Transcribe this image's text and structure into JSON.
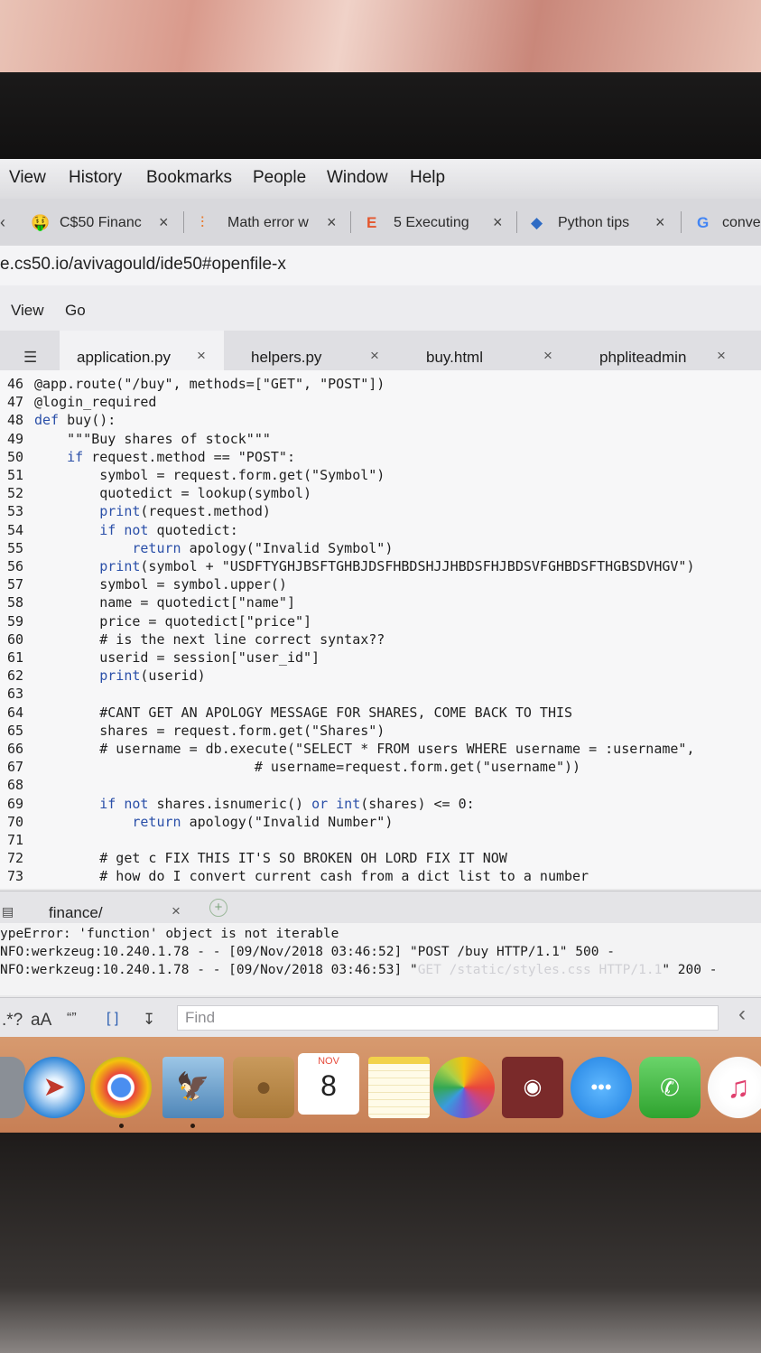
{
  "menubar": {
    "items": [
      "View",
      "History",
      "Bookmarks",
      "People",
      "Window",
      "Help"
    ]
  },
  "tabs": [
    {
      "label": "C$50 Financ",
      "icon": "money-face-icon"
    },
    {
      "label": "Math error w",
      "icon": "stack-overflow-icon"
    },
    {
      "label": "5 Executing",
      "icon": "e-logo-icon"
    },
    {
      "label": "Python tips",
      "icon": "python-icon"
    },
    {
      "label": "conve",
      "icon": "google-g-icon"
    }
  ],
  "url": "e.cs50.io/avivagould/ide50#openfile-x",
  "ide_menu": [
    "View",
    "Go"
  ],
  "editor_tabs": [
    "application.py",
    "helpers.py",
    "buy.html",
    "phpliteadmin"
  ],
  "code_lines": [
    {
      "n": "46",
      "t": "@app.route(\"/buy\", methods=[\"GET\", \"POST\"])"
    },
    {
      "n": "47",
      "t": "@login_required"
    },
    {
      "n": "48",
      "t": "def buy():"
    },
    {
      "n": "49",
      "t": "    \"\"\"Buy shares of stock\"\"\""
    },
    {
      "n": "50",
      "t": "    if request.method == \"POST\":"
    },
    {
      "n": "51",
      "t": "        symbol = request.form.get(\"Symbol\")"
    },
    {
      "n": "52",
      "t": "        quotedict = lookup(symbol)"
    },
    {
      "n": "53",
      "t": "        print(request.method)"
    },
    {
      "n": "54",
      "t": "        if not quotedict:"
    },
    {
      "n": "55",
      "t": "            return apology(\"Invalid Symbol\")"
    },
    {
      "n": "56",
      "t": "        print(symbol + \"USDFTYGHJBSFTGHBJDSFHBDSHJJHBDSFHJBDSVFGHBDSFTHGBSDVHGV\")"
    },
    {
      "n": "57",
      "t": "        symbol = symbol.upper()"
    },
    {
      "n": "58",
      "t": "        name = quotedict[\"name\"]"
    },
    {
      "n": "59",
      "t": "        price = quotedict[\"price\"]"
    },
    {
      "n": "60",
      "t": "        # is the next line correct syntax??"
    },
    {
      "n": "61",
      "t": "        userid = session[\"user_id\"]"
    },
    {
      "n": "62",
      "t": "        print(userid)"
    },
    {
      "n": "63",
      "t": ""
    },
    {
      "n": "64",
      "t": "        #CANT GET AN APOLOGY MESSAGE FOR SHARES, COME BACK TO THIS"
    },
    {
      "n": "65",
      "t": "        shares = request.form.get(\"Shares\")"
    },
    {
      "n": "66",
      "t": "        # username = db.execute(\"SELECT * FROM users WHERE username = :username\","
    },
    {
      "n": "67",
      "t": "                           # username=request.form.get(\"username\"))"
    },
    {
      "n": "68",
      "t": ""
    },
    {
      "n": "69",
      "t": "        if not shares.isnumeric() or int(shares) <= 0:"
    },
    {
      "n": "70",
      "t": "            return apology(\"Invalid Number\")"
    },
    {
      "n": "71",
      "t": ""
    },
    {
      "n": "72",
      "t": "        # get c FIX THIS IT'S SO BROKEN OH LORD FIX IT NOW"
    },
    {
      "n": "73",
      "t": "        # how do I convert current cash from a dict list to a number"
    }
  ],
  "terminal": {
    "tab_label": "finance/",
    "lines": [
      {
        "a": "ypeError: 'function' object is not iterable",
        "b": "",
        "c": ""
      },
      {
        "a": "NFO:werkzeug:10.240.1.78 - - [09/Nov/2018 03:46:52] \"POST /buy HTTP/1.1\" 500 -",
        "b": "",
        "c": ""
      },
      {
        "a": "NFO:werkzeug:10.240.1.78 - - [09/Nov/2018 03:46:53] \"",
        "b": "GET /static/styles.css HTTP/1.1",
        "c": "\" 200 -"
      }
    ]
  },
  "findbar": {
    "options": [
      ".*?",
      "aA",
      "“”",
      "[ ]",
      "↧"
    ],
    "placeholder": "Find"
  },
  "dock": {
    "calendar_month": "NOV",
    "calendar_day": "8"
  }
}
